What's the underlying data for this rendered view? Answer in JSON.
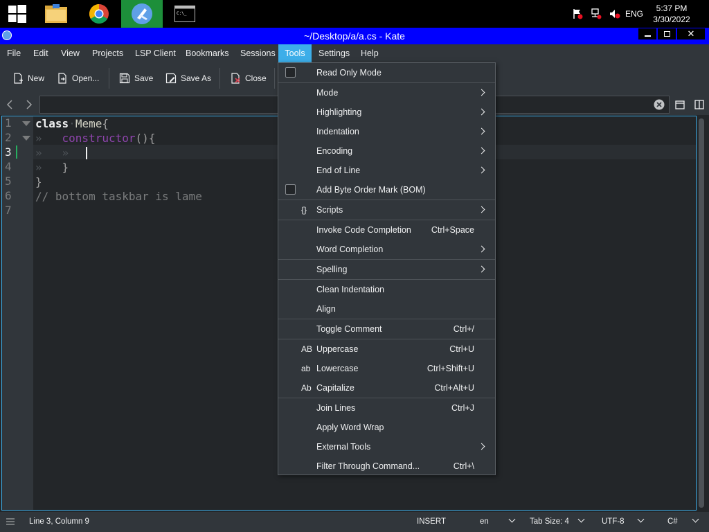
{
  "taskbar": {
    "clock_time": "5:37 PM",
    "clock_date": "3/30/2022",
    "language": "ENG"
  },
  "window": {
    "title": "~/Desktop/a/a.cs  - Kate"
  },
  "menubar": {
    "items": [
      "File",
      "Edit",
      "View",
      "Projects",
      "LSP Client",
      "Bookmarks",
      "Sessions",
      "Tools",
      "Settings",
      "Help"
    ]
  },
  "toolbar": {
    "new_label": "New",
    "open_label": "Open...",
    "save_label": "Save",
    "saveas_label": "Save As",
    "close_label": "Close"
  },
  "editor": {
    "line_numbers": [
      "1",
      "2",
      "3",
      "4",
      "5",
      "6",
      "7"
    ],
    "line1_kw": "class",
    "line1_name": "Meme",
    "line1_brace": "{",
    "line2_fn": "constructor",
    "line2_rest": "(){",
    "line3_ws": "»",
    "line4_brace": "}",
    "line5_brace": "}",
    "line6_comment": "// bottom taskbar is lame"
  },
  "tools_menu": {
    "read_only": "Read Only Mode",
    "mode": "Mode",
    "highlighting": "Highlighting",
    "indentation": "Indentation",
    "encoding": "Encoding",
    "end_of_line": "End of Line",
    "add_bom": "Add Byte Order Mark (BOM)",
    "scripts": "Scripts",
    "scripts_glyph": "{}",
    "invoke_completion": "Invoke Code Completion",
    "invoke_completion_sc": "Ctrl+Space",
    "word_completion": "Word Completion",
    "spelling": "Spelling",
    "clean_indentation": "Clean Indentation",
    "align": "Align",
    "toggle_comment": "Toggle Comment",
    "toggle_comment_sc": "Ctrl+/",
    "uppercase": "Uppercase",
    "uppercase_sc": "Ctrl+U",
    "uppercase_glyph": "AB",
    "lowercase": "Lowercase",
    "lowercase_sc": "Ctrl+Shift+U",
    "lowercase_glyph": "ab",
    "capitalize": "Capitalize",
    "capitalize_sc": "Ctrl+Alt+U",
    "capitalize_glyph": "Ab",
    "join_lines": "Join Lines",
    "join_lines_sc": "Ctrl+J",
    "apply_word_wrap": "Apply Word Wrap",
    "external_tools": "External Tools",
    "filter_command": "Filter Through Command...",
    "filter_command_sc": "Ctrl+\\"
  },
  "statusbar": {
    "position": "Line 3, Column 9",
    "mode": "INSERT",
    "language": "en",
    "tab_size": "Tab Size: 4",
    "encoding": "UTF-8",
    "syntax": "C#"
  },
  "colors": {
    "accent": "#3daee9",
    "titlebar": "#0000ff",
    "background": "#232629",
    "panel": "#31363b"
  }
}
